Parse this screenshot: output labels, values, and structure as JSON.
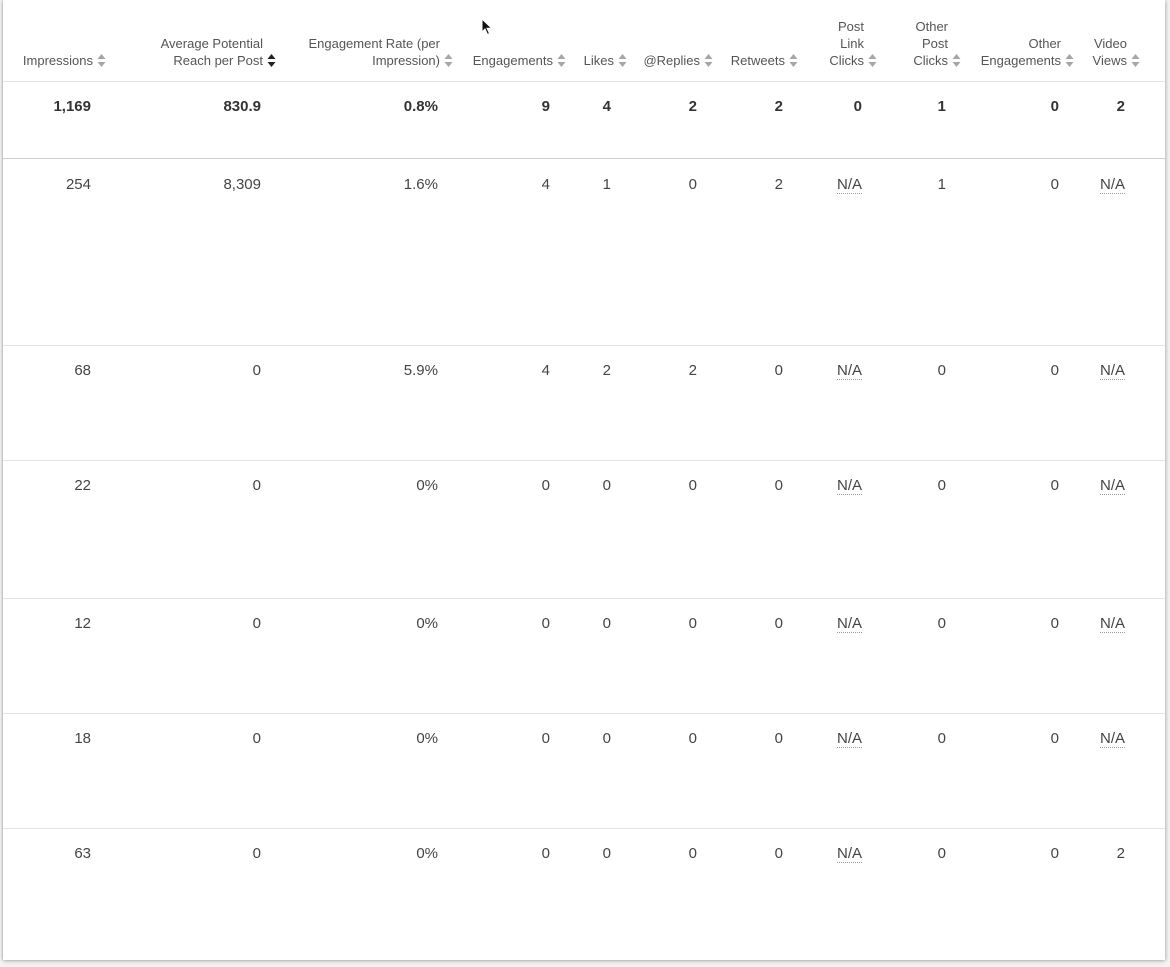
{
  "columns": [
    {
      "key": "impressions",
      "label": [
        "Impressions"
      ],
      "sort": "none"
    },
    {
      "key": "avg_reach",
      "label": [
        "Average Potential",
        "Reach per Post"
      ],
      "sort": "desc"
    },
    {
      "key": "eng_rate",
      "label": [
        "Engagement Rate (per",
        "Impression)"
      ],
      "sort": "none"
    },
    {
      "key": "engagements",
      "label": [
        "Engagements"
      ],
      "sort": "none"
    },
    {
      "key": "likes",
      "label": [
        "Likes"
      ],
      "sort": "none"
    },
    {
      "key": "replies",
      "label": [
        "@Replies"
      ],
      "sort": "none"
    },
    {
      "key": "retweets",
      "label": [
        "Retweets"
      ],
      "sort": "none"
    },
    {
      "key": "post_link_clicks",
      "label": [
        "Post",
        "Link",
        "Clicks"
      ],
      "sort": "none"
    },
    {
      "key": "other_post_clicks",
      "label": [
        "Other",
        "Post",
        "Clicks"
      ],
      "sort": "none"
    },
    {
      "key": "other_engagements",
      "label": [
        "Other",
        "Engagements"
      ],
      "sort": "none"
    },
    {
      "key": "video_views",
      "label": [
        "Video",
        "Views"
      ],
      "sort": "none"
    }
  ],
  "totals": [
    "1,169",
    "830.9",
    "0.8%",
    "9",
    "4",
    "2",
    "2",
    "0",
    "1",
    "0",
    "2"
  ],
  "rows": [
    [
      "254",
      "8,309",
      "1.6%",
      "4",
      "1",
      "0",
      "2",
      "N/A",
      "1",
      "0",
      "N/A"
    ],
    [
      "68",
      "0",
      "5.9%",
      "4",
      "2",
      "2",
      "0",
      "N/A",
      "0",
      "0",
      "N/A"
    ],
    [
      "22",
      "0",
      "0%",
      "0",
      "0",
      "0",
      "0",
      "N/A",
      "0",
      "0",
      "N/A"
    ],
    [
      "12",
      "0",
      "0%",
      "0",
      "0",
      "0",
      "0",
      "N/A",
      "0",
      "0",
      "N/A"
    ],
    [
      "18",
      "0",
      "0%",
      "0",
      "0",
      "0",
      "0",
      "N/A",
      "0",
      "0",
      "N/A"
    ],
    [
      "63",
      "0",
      "0%",
      "0",
      "0",
      "0",
      "0",
      "N/A",
      "0",
      "0",
      "2"
    ]
  ],
  "colors": {
    "sort_inactive": "#a6a6a6",
    "sort_active": "#222222",
    "divider": "#e3e3e3"
  }
}
